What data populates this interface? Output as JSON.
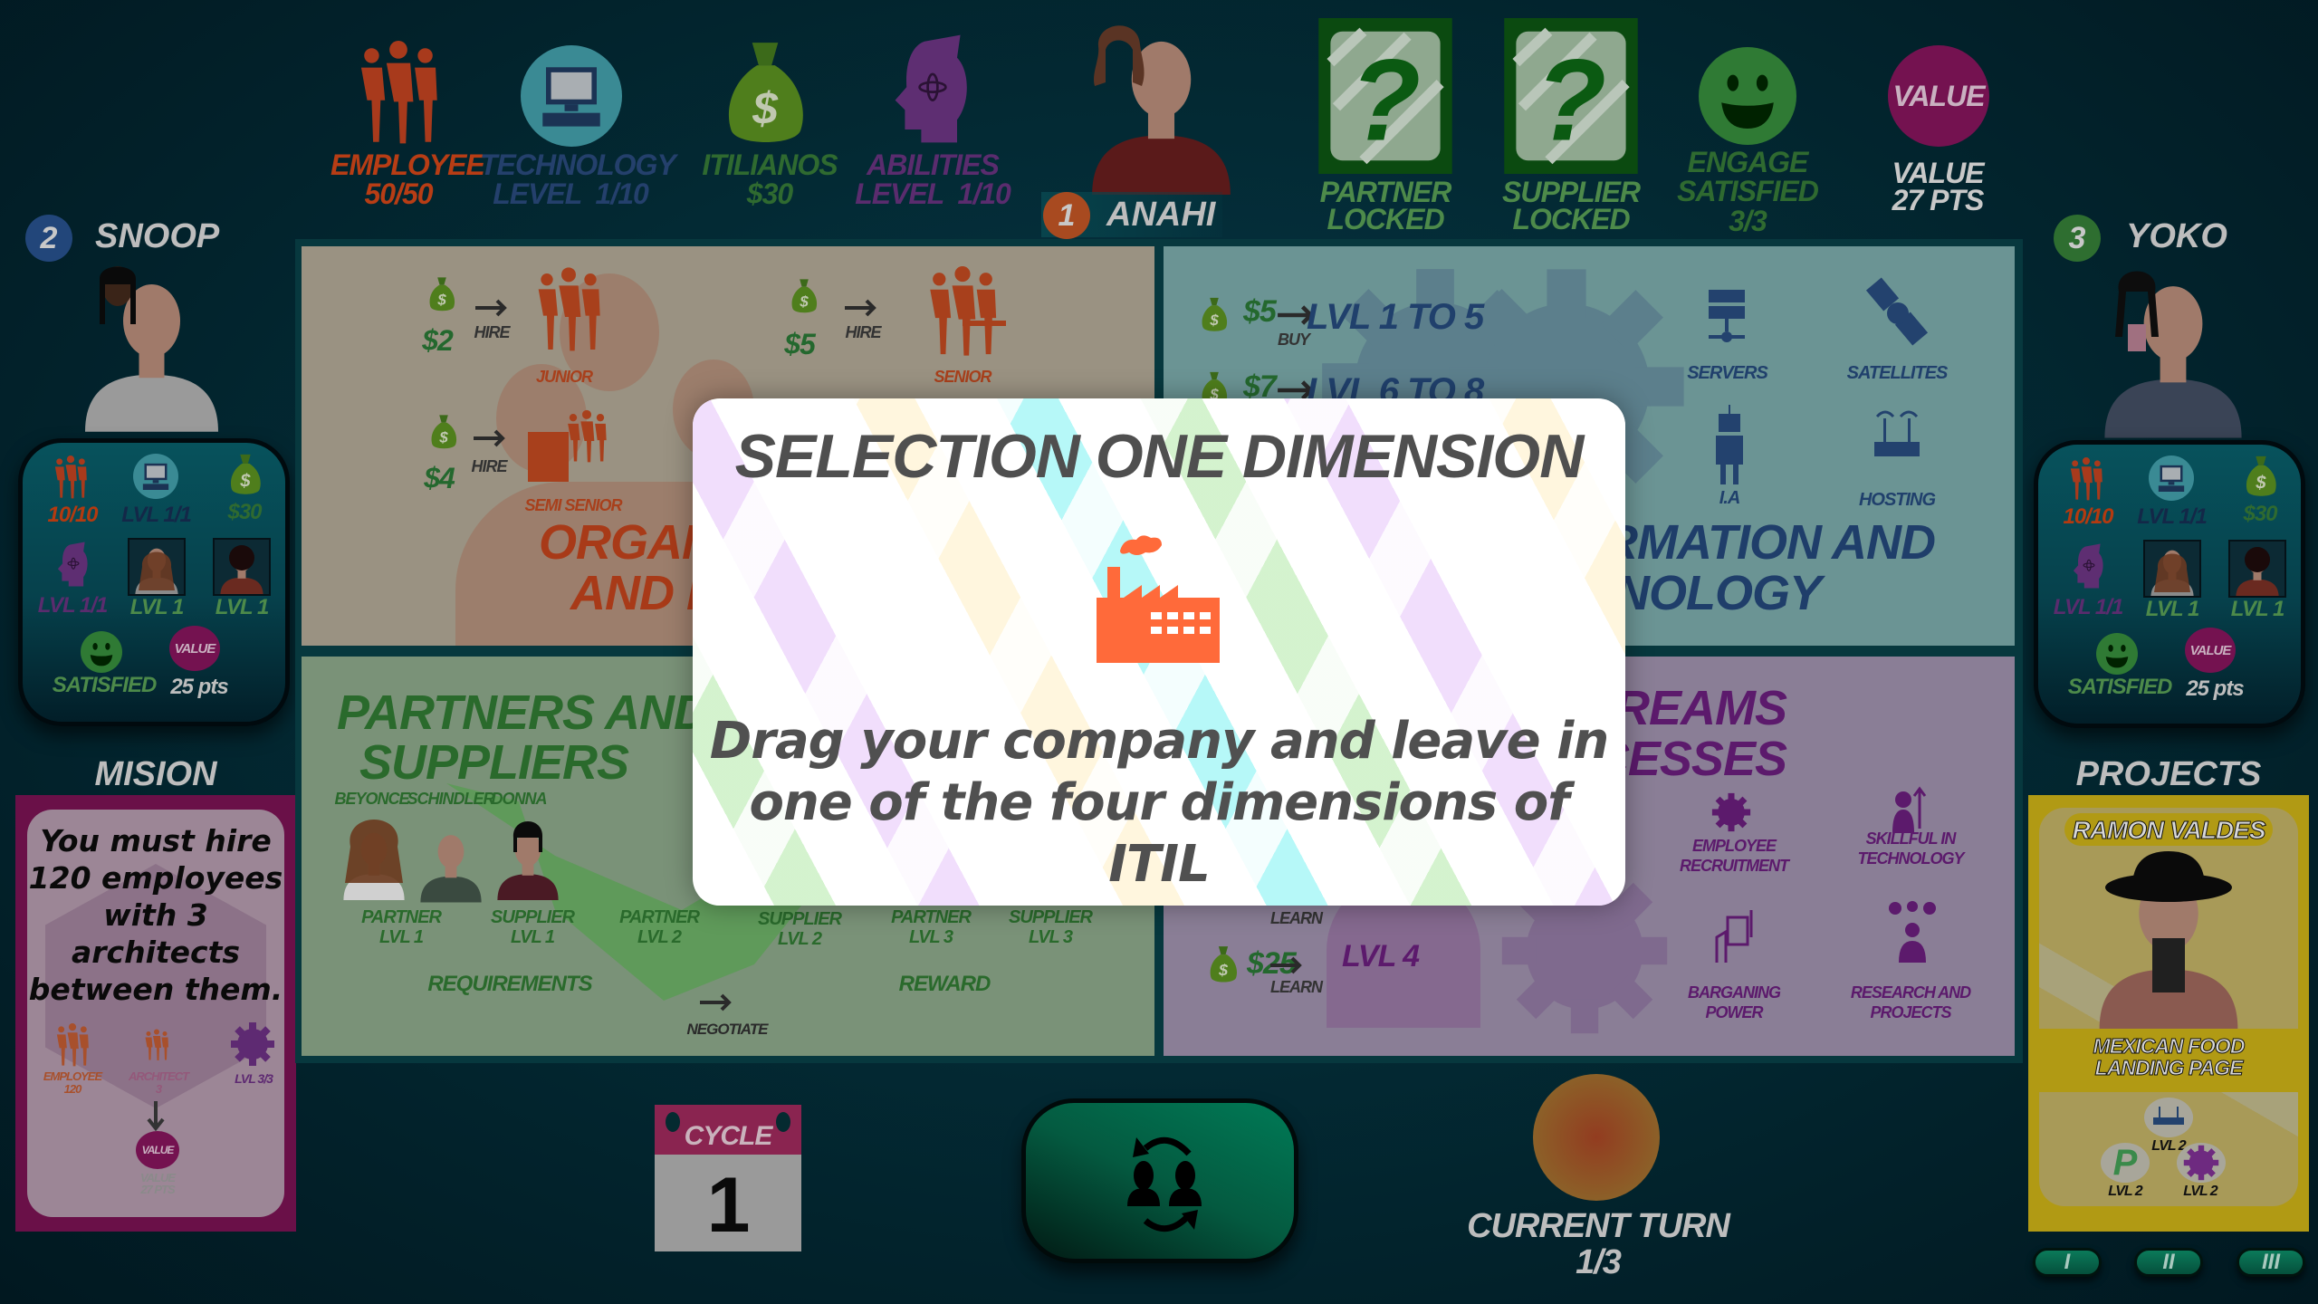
{
  "top_stats": {
    "employee": {
      "label": "EMPLOYEE",
      "value": "50/50"
    },
    "technology": {
      "label": "TECHNOLOGY",
      "value": "LEVEL  1/10"
    },
    "itilianos": {
      "label": "ITILIANOS",
      "value": "$30"
    },
    "abilities": {
      "label": "ABILITIES",
      "value": "LEVEL  1/10"
    },
    "partner": {
      "label": "PARTNER",
      "status": "LOCKED"
    },
    "supplier": {
      "label": "SUPPLIER",
      "status": "LOCKED"
    },
    "engage": {
      "label": "ENGAGE",
      "status": "SATISFIED",
      "value": "3/3"
    },
    "value": {
      "badge": "VALUE",
      "label": "VALUE",
      "value": "27 PTS"
    }
  },
  "current_player": {
    "number": "1",
    "name": "ANAHI"
  },
  "players": [
    {
      "number": "2",
      "name": "SNOOP",
      "employees": "10/10",
      "technology": "LVL 1/1",
      "money": "$30",
      "abilities": "LVL 1/1",
      "partner": "LVL 1",
      "supplier": "LVL 1",
      "satisfied": "SATISFIED",
      "value_badge": "VALUE",
      "points": "25 pts"
    },
    {
      "number": "3",
      "name": "YOKO",
      "employees": "10/10",
      "technology": "LVL 1/1",
      "money": "$30",
      "abilities": "LVL 1/1",
      "partner": "LVL 1",
      "supplier": "LVL 1",
      "satisfied": "SATISFIED",
      "value_badge": "VALUE",
      "points": "25 pts"
    }
  ],
  "mission": {
    "title": "MISION",
    "lines": [
      "You must hire",
      "120 employees",
      "with 3",
      "architects",
      "between them."
    ],
    "req_employee": "EMPLOYEE",
    "req_employee_value": "120",
    "req_architect": "ARCHITECT",
    "req_architect_value": "3",
    "req_level": "LVL 3/3",
    "value_badge": "VALUE",
    "reward_label": "VALUE",
    "reward_value": "27 PTS"
  },
  "board": {
    "organizations": {
      "title": [
        "ORGANIZATIONS",
        "AND PEOPLE"
      ],
      "hires": [
        {
          "cost": "$2",
          "action": "HIRE",
          "role": "JUNIOR"
        },
        {
          "cost": "$5",
          "action": "HIRE",
          "role": "SENIOR"
        },
        {
          "cost": "$4",
          "action": "HIRE",
          "role": "SEMI SENIOR"
        }
      ]
    },
    "technology": {
      "title": [
        "INFORMATION AND",
        "TECHNOLOGY"
      ],
      "buys": [
        {
          "cost": "$5",
          "action": "BUY",
          "range": "LVL 1 TO 5"
        },
        {
          "cost": "$7",
          "range": "LVL 6 TO 8"
        }
      ],
      "items": [
        "SERVERS",
        "SATELLITES",
        "I.A",
        "HOSTING"
      ]
    },
    "partners": {
      "title": [
        "PARTNERS AND",
        "SUPPLIERS"
      ],
      "people": [
        "BEYONCE",
        "SCHINDLER",
        "DONNA"
      ],
      "tiers": [
        {
          "type": "PARTNER",
          "level": "LVL 1"
        },
        {
          "type": "SUPPLIER",
          "level": "LVL 1"
        },
        {
          "type": "PARTNER",
          "level": "LVL 2"
        },
        {
          "type": "SUPPLIER",
          "level": "LVL 2"
        },
        {
          "type": "PARTNER",
          "level": "LVL 3"
        },
        {
          "type": "SUPPLIER",
          "level": "LVL 3"
        }
      ],
      "requirements": "REQUIREMENTS",
      "reward": "REWARD",
      "negotiate": "NEGOTIATE"
    },
    "value_streams": {
      "title": [
        "VALUE STREAMS",
        "AND PROCESSES"
      ],
      "learn_top": "LEARN",
      "learn": {
        "cost": "$25",
        "action": "LEARN",
        "level": "LVL 4"
      },
      "items": [
        [
          "EMPLOYEE",
          "RECRUITMENT"
        ],
        [
          "SKILLFUL IN",
          "TECHNOLOGY"
        ],
        [
          "BARGANING",
          "POWER"
        ],
        [
          "RESEARCH AND",
          "PROJECTS"
        ]
      ]
    }
  },
  "modal": {
    "title": "SELECTION ONE DIMENSION",
    "message": [
      "Drag your company and leave in",
      "one of the four dimensions of ITIL"
    ]
  },
  "bottom": {
    "cycle_label": "CYCLE",
    "cycle": "1",
    "turn_label": "CURRENT TURN",
    "turn": "1/3"
  },
  "projects": {
    "title": "PROJECTS",
    "client": "RAMON VALDES",
    "project": [
      "MEXICAN FOOD",
      "LANDING PAGE"
    ],
    "requirements": [
      "LVL 2",
      "LVL 2",
      "LVL 2"
    ],
    "pages": [
      "I",
      "II",
      "III"
    ]
  }
}
